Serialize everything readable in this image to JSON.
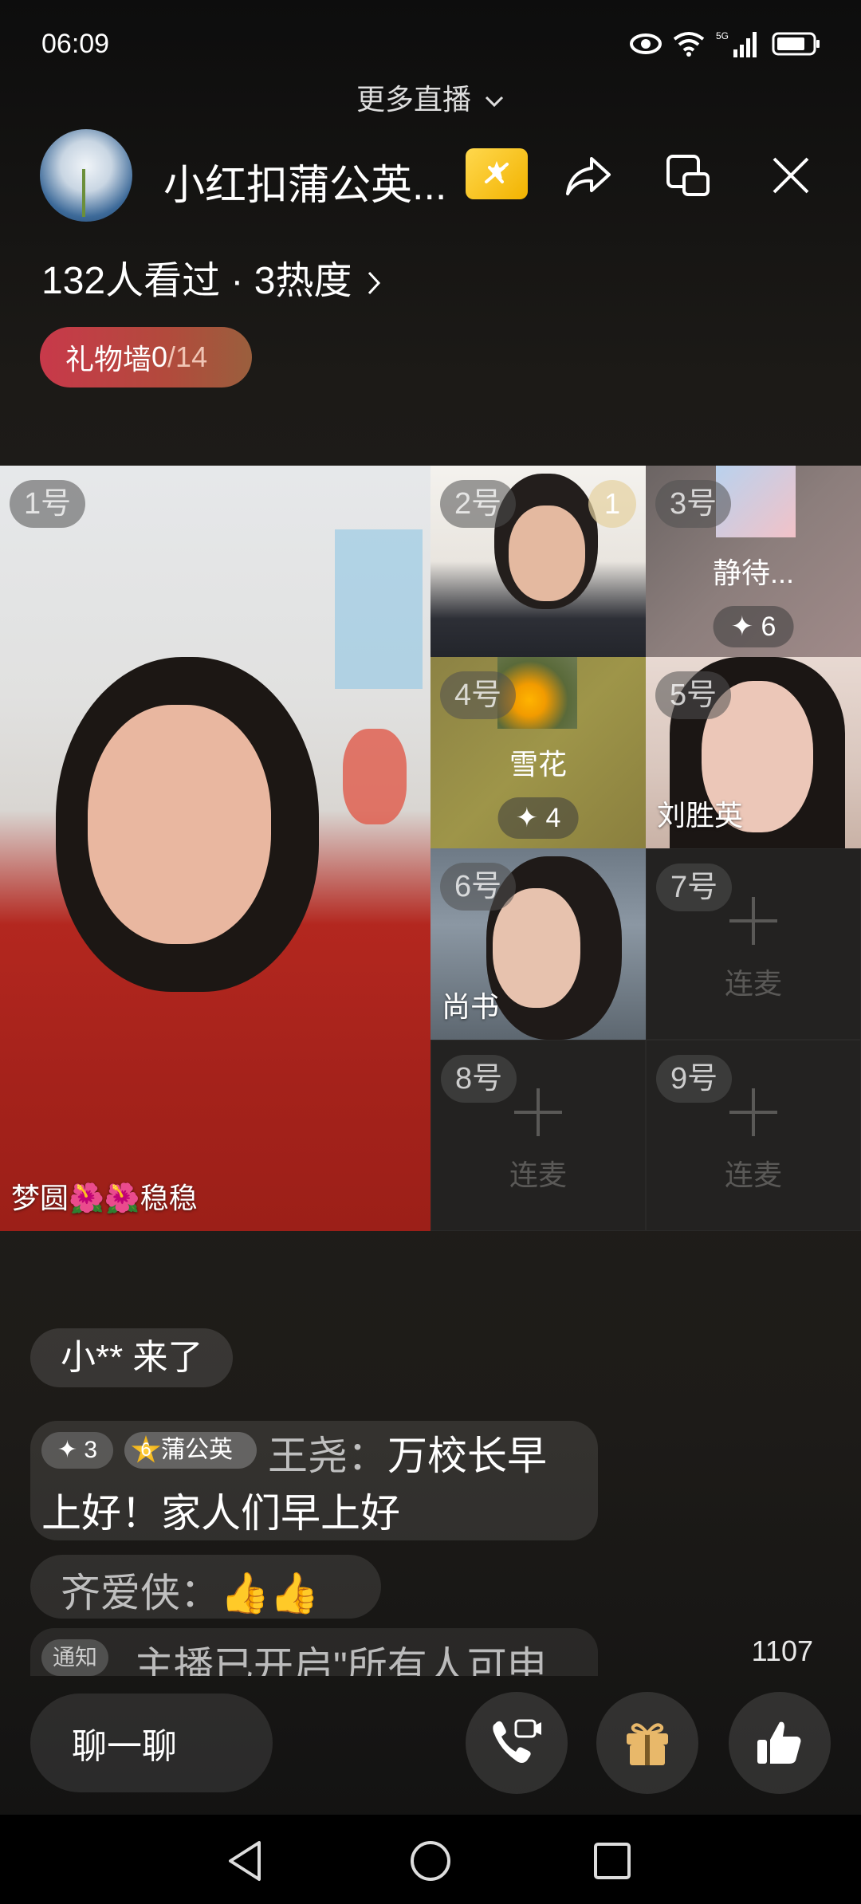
{
  "status": {
    "time": "06:09",
    "network": "5G"
  },
  "header": {
    "more_live": "更多直播",
    "room_title": "小红扣蒲公英...",
    "viewers": "132人看过 · 3热度",
    "gift_wall": {
      "label": "礼物墙",
      "count": "0",
      "total": "/14"
    }
  },
  "seats": [
    {
      "num": "1号",
      "name": "梦圆🌺🌺稳稳"
    },
    {
      "num": "2号",
      "badge": "1"
    },
    {
      "num": "3号",
      "name": "静待...",
      "score": "✦ 6"
    },
    {
      "num": "4号",
      "name": "雪花",
      "score": "✦ 4"
    },
    {
      "num": "5号",
      "name": "刘胜英"
    },
    {
      "num": "6号",
      "name": "尚书"
    },
    {
      "num": "7号",
      "action": "连麦"
    },
    {
      "num": "8号",
      "action": "连麦"
    },
    {
      "num": "9号",
      "action": "连麦"
    }
  ],
  "chat": {
    "join": "小** 来了",
    "msg1": {
      "level": "✦ 3",
      "fan_level": "6",
      "fan_badge": "蒲公英",
      "nick": "王尧：",
      "text_a": "万校长早",
      "text_b": "上好！家人们早上好"
    },
    "msg2": {
      "nick": "齐爱侠：",
      "text": "👍👍"
    },
    "msg3": {
      "tag": "通知",
      "text": "主播已开启\"所有人可申"
    },
    "like_count": "1107"
  },
  "bottom": {
    "chat_label": "聊一聊"
  }
}
